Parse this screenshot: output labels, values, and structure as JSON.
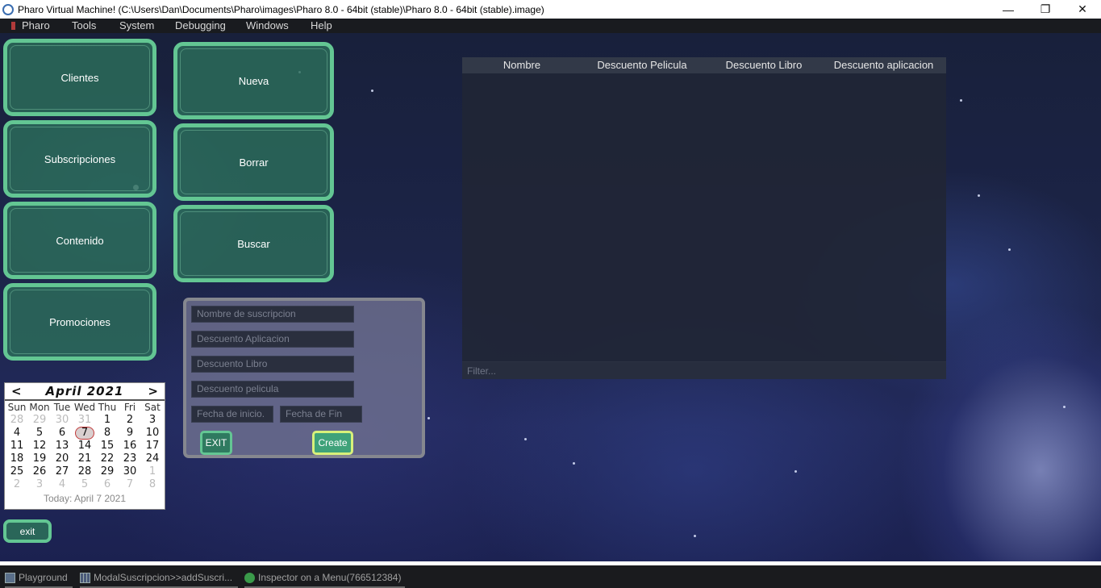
{
  "window": {
    "title": "Pharo Virtual Machine! (C:\\Users\\Dan\\Documents\\Pharo\\images\\Pharo 8.0 - 64bit (stable)\\Pharo 8.0 - 64bit (stable).image)",
    "minimize_glyph": "—",
    "maximize_glyph": "❐",
    "close_glyph": "✕"
  },
  "menubar": {
    "items": [
      "Pharo",
      "Tools",
      "System",
      "Debugging",
      "Windows",
      "Help"
    ]
  },
  "left_buttons": {
    "clientes": "Clientes",
    "subscripciones": "Subscripciones",
    "contenido": "Contenido",
    "promociones": "Promociones"
  },
  "action_buttons": {
    "nueva": "Nueva",
    "borrar": "Borrar",
    "buscar": "Buscar"
  },
  "calendar": {
    "prev": "<",
    "next": ">",
    "month": "April 2021",
    "weekdays": [
      "Sun",
      "Mon",
      "Tue",
      "Wed",
      "Thu",
      "Fri",
      "Sat"
    ],
    "weeks": [
      [
        "28",
        "29",
        "30",
        "31",
        "1",
        "2",
        "3"
      ],
      [
        "4",
        "5",
        "6",
        "7",
        "8",
        "9",
        "10"
      ],
      [
        "11",
        "12",
        "13",
        "14",
        "15",
        "16",
        "17"
      ],
      [
        "18",
        "19",
        "20",
        "21",
        "22",
        "23",
        "24"
      ],
      [
        "25",
        "26",
        "27",
        "28",
        "29",
        "30",
        "1"
      ],
      [
        "2",
        "3",
        "4",
        "5",
        "6",
        "7",
        "8"
      ]
    ],
    "today_label": "Today: April 7 2021",
    "selected_day": "7"
  },
  "exit_button": "exit",
  "form": {
    "nombre_placeholder": "Nombre de suscripcion",
    "descuento_aplicacion_placeholder": "Descuento Aplicacion",
    "descuento_libro_placeholder": "Descuento Libro",
    "descuento_pelicula_placeholder": "Descuento pelicula",
    "fecha_inicio_placeholder": "Fecha de inicio.",
    "fecha_fin_placeholder": "Fecha de Fin",
    "exit_label": "EXIT",
    "create_label": "Create"
  },
  "table": {
    "columns": [
      "Nombre",
      "Descuento Pelicula",
      "Descuento Libro",
      "Descuento aplicacion"
    ],
    "rows": [],
    "filter_placeholder": "Filter..."
  },
  "taskbar": {
    "items": [
      "Playground",
      "ModalSuscripcion>>addSuscri...",
      "Inspector on a Menu(766512384)"
    ]
  },
  "colors": {
    "button_border": "#63c693",
    "button_fill": "#2c6e5a",
    "create_border": "#d8f07a"
  }
}
